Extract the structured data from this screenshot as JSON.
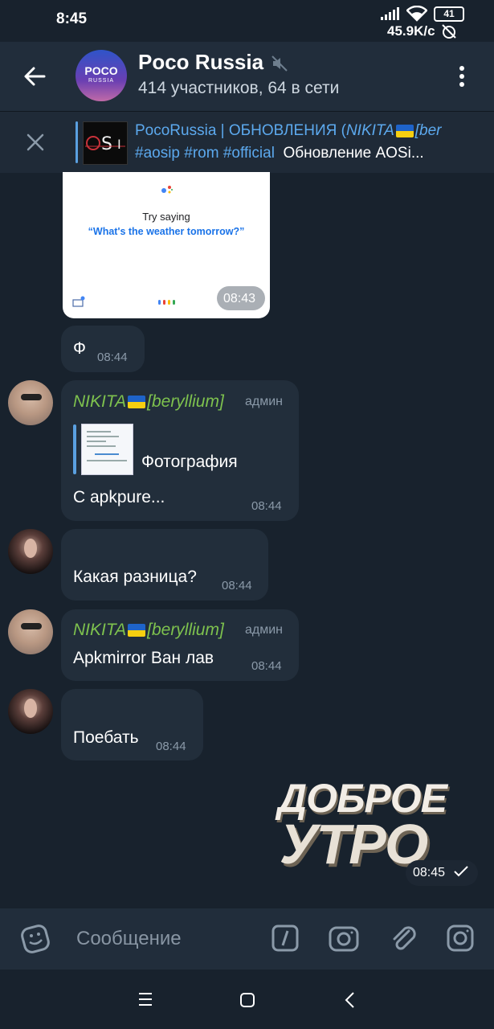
{
  "status": {
    "time": "8:45",
    "battery": "41",
    "speed": "45.9K/с"
  },
  "header": {
    "title": "Poco Russia",
    "subtitle": "414 участников, 64 в сети",
    "avatar_line1": "POCO",
    "avatar_line2": "RUSSIA"
  },
  "pinned": {
    "title_plain": "PocoRussia | ОБНОВЛЕНИЯ (",
    "title_name": "NIKITA",
    "title_tail": "[ber",
    "tags": "#aosip #rom #official",
    "text": "Обновление AOSi..."
  },
  "image_message": {
    "line1": "Try saying",
    "line2": "“What's the weather tomorrow?”",
    "time": "08:43"
  },
  "messages": [
    {
      "text": "Ф",
      "time": "08:44"
    },
    {
      "sender": "NIKITA",
      "sender_tail": "[beryllium]",
      "role": "админ",
      "reply_label": "Фотография",
      "text": "С apkpure...",
      "time": "08:44"
    },
    {
      "text": "Какая разница?",
      "time": "08:44"
    },
    {
      "sender": "NIKITA",
      "sender_tail": "[beryllium]",
      "role": "админ",
      "text": "Apkmirror Ван лав",
      "time": "08:44"
    },
    {
      "text": "Поебать",
      "time": "08:44"
    }
  ],
  "sticker": {
    "line1": "ДОБРОЕ",
    "line2": "УТРО",
    "time": "08:45"
  },
  "composer": {
    "placeholder": "Сообщение"
  },
  "icons": [
    "back-arrow-icon",
    "mute-icon",
    "more-vert-icon",
    "close-icon",
    "emoji-icon",
    "bot-command-icon",
    "camera-icon",
    "attach-icon",
    "instagram-icon",
    "menu-nav-icon",
    "home-nav-icon",
    "back-nav-icon",
    "check-icon"
  ]
}
